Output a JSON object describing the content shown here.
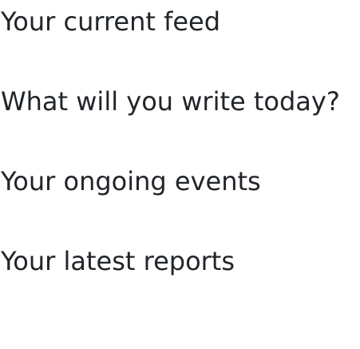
{
  "headings": {
    "feed": "Your current feed",
    "write": "What will you write today?",
    "events": "Your ongoing events",
    "reports": "Your latest reports"
  }
}
